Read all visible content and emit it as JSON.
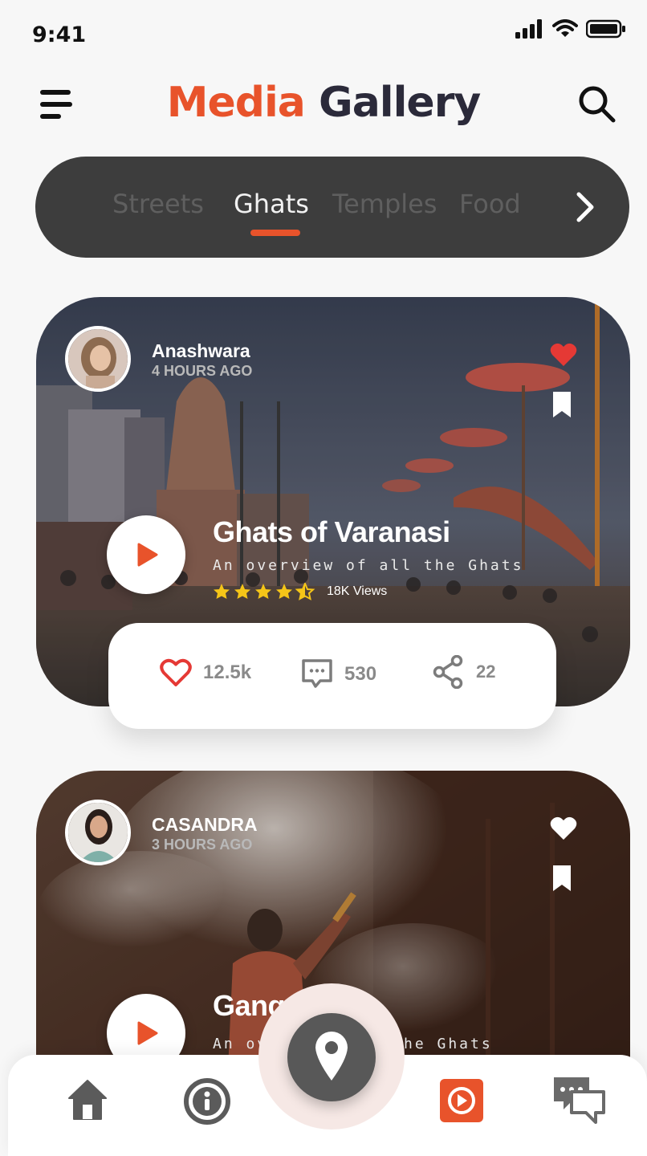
{
  "status": {
    "time": "9:41"
  },
  "header": {
    "title_part1": "Media",
    "title_part2": "Gallery"
  },
  "tabs": [
    {
      "label": "Streets",
      "active": false
    },
    {
      "label": "Ghats",
      "active": true
    },
    {
      "label": "Temples",
      "active": false
    },
    {
      "label": "Food",
      "active": false
    }
  ],
  "posts": [
    {
      "author": "Anashwara",
      "time": "4 HOURS AGO",
      "title": "Ghats of Varanasi",
      "subtitle": "An overview of all the Ghats",
      "rating": 4.5,
      "views": "18K Views",
      "liked": true,
      "stats": {
        "likes": "12.5k",
        "comments": "530",
        "shares": "22"
      }
    },
    {
      "author": "CASANDRA",
      "time": "3 HOURS AGO",
      "title": "Gang",
      "subtitle": "An ov",
      "subtitle_tail": "he Ghats",
      "liked": false
    }
  ],
  "nav": {
    "items": [
      "home-icon",
      "info-icon",
      "location-pin-icon",
      "video-icon",
      "chat-icon"
    ],
    "active": "video-icon"
  },
  "colors": {
    "accent": "#e8532b",
    "dark": "#3d3d3d",
    "heart": "#e53935",
    "star": "#f5c518"
  }
}
